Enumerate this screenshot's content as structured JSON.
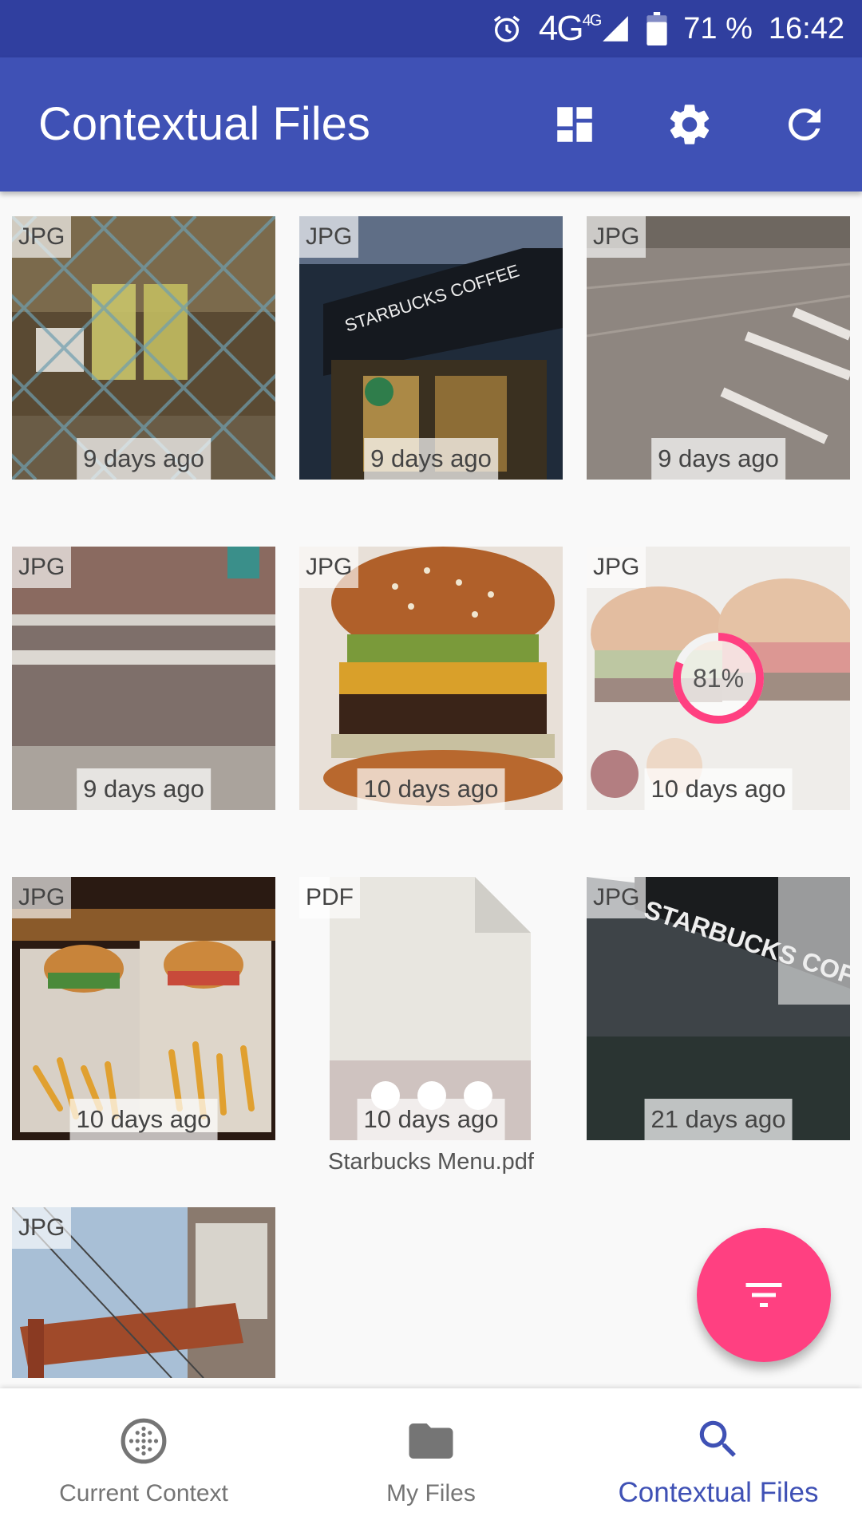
{
  "status_bar": {
    "network": "4G",
    "network_sup": "4G",
    "battery": "71 %",
    "time": "16:42",
    "icons": [
      "alarm-icon",
      "signal-icon",
      "battery-icon"
    ]
  },
  "app_bar": {
    "title": "Contextual Files",
    "actions": [
      "dashboard-icon",
      "settings-icon",
      "refresh-icon"
    ]
  },
  "files": [
    {
      "type": "JPG",
      "age": "9 days ago",
      "thumbnail": "cafe-cups-behind-fence"
    },
    {
      "type": "JPG",
      "age": "9 days ago",
      "thumbnail": "starbucks-storefront-night"
    },
    {
      "type": "JPG",
      "age": "9 days ago",
      "thumbnail": "paved-street"
    },
    {
      "type": "JPG",
      "age": "9 days ago",
      "thumbnail": "brick-pavement-lines"
    },
    {
      "type": "JPG",
      "age": "10 days ago",
      "thumbnail": "burger"
    },
    {
      "type": "JPG",
      "age": "10 days ago",
      "thumbnail": "two-burgers",
      "progress_label": "81%",
      "progress": 0.81
    },
    {
      "type": "JPG",
      "age": "10 days ago",
      "thumbnail": "burgers-and-fries"
    },
    {
      "type": "PDF",
      "age": "10 days ago",
      "thumbnail": "pdf-document",
      "name": "Starbucks Menu.pdf"
    },
    {
      "type": "JPG",
      "age": "21 days ago",
      "thumbnail": "starbucks-coffee-sign"
    },
    {
      "type": "JPG",
      "age": "",
      "thumbnail": "brick-tower"
    }
  ],
  "fab": {
    "icon": "filter-icon"
  },
  "bottom_nav": {
    "items": [
      {
        "label": "Current Context",
        "icon": "context-icon",
        "active": false
      },
      {
        "label": "My Files",
        "icon": "folder-icon",
        "active": false
      },
      {
        "label": "Contextual Files",
        "icon": "search-icon",
        "active": true
      }
    ]
  },
  "colors": {
    "primary": "#3f51b5",
    "primary_dark": "#303f9f",
    "accent": "#ff4081"
  }
}
